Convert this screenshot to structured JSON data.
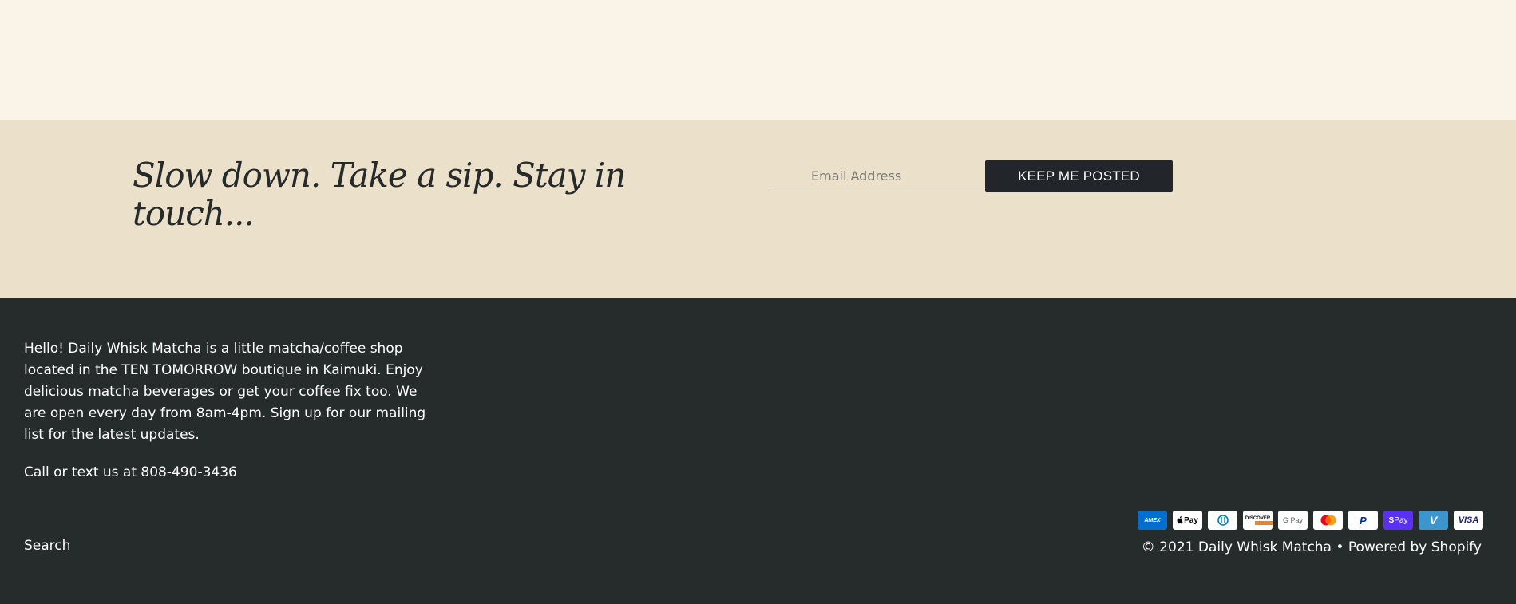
{
  "newsletter": {
    "heading": "Slow down. Take a sip. Stay in touch...",
    "email_placeholder": "Email Address",
    "button_label": "KEEP ME POSTED"
  },
  "footer": {
    "about": "Hello! Daily Whisk Matcha is a little matcha/coffee shop located in the TEN TOMORROW boutique in Kaimuki. Enjoy delicious matcha beverages or get your coffee fix too. We are open every day from 8am-4pm. Sign up for our mailing list for the latest updates.",
    "contact": "Call or text us at 808-490-3436",
    "search_link": "Search",
    "copyright_prefix": "© 2021 ",
    "shop_name": "Daily Whisk Matcha",
    "separator": " • ",
    "powered_by": "Powered by Shopify"
  },
  "payments": [
    {
      "name": "American Express",
      "icon": "amex-icon",
      "label": "AMEX",
      "bg": "#016fd0",
      "fg": "#ffffff"
    },
    {
      "name": "Apple Pay",
      "icon": "apple-pay-icon",
      "label": "Pay",
      "bg": "#ffffff",
      "fg": "#000000"
    },
    {
      "name": "Diners Club",
      "icon": "diners-club-icon",
      "label": "",
      "bg": "#ffffff",
      "fg": "#0079be"
    },
    {
      "name": "Discover",
      "icon": "discover-icon",
      "label": "DISCOVER",
      "bg": "#ffffff",
      "fg": "#000000"
    },
    {
      "name": "Google Pay",
      "icon": "google-pay-icon",
      "label": "G Pay",
      "bg": "#ffffff",
      "fg": "#5f6368"
    },
    {
      "name": "Mastercard",
      "icon": "mastercard-icon",
      "label": "",
      "bg": "#ffffff",
      "fg": "#000000"
    },
    {
      "name": "PayPal",
      "icon": "paypal-icon",
      "label": "P",
      "bg": "#ffffff",
      "fg": "#003087"
    },
    {
      "name": "Shop Pay",
      "icon": "shop-pay-icon",
      "label": "Pay",
      "bg": "#5a31f4",
      "fg": "#ffffff"
    },
    {
      "name": "Venmo",
      "icon": "venmo-icon",
      "label": "V",
      "bg": "#3d95ce",
      "fg": "#ffffff"
    },
    {
      "name": "Visa",
      "icon": "visa-icon",
      "label": "VISA",
      "bg": "#ffffff",
      "fg": "#1a1f71"
    }
  ]
}
